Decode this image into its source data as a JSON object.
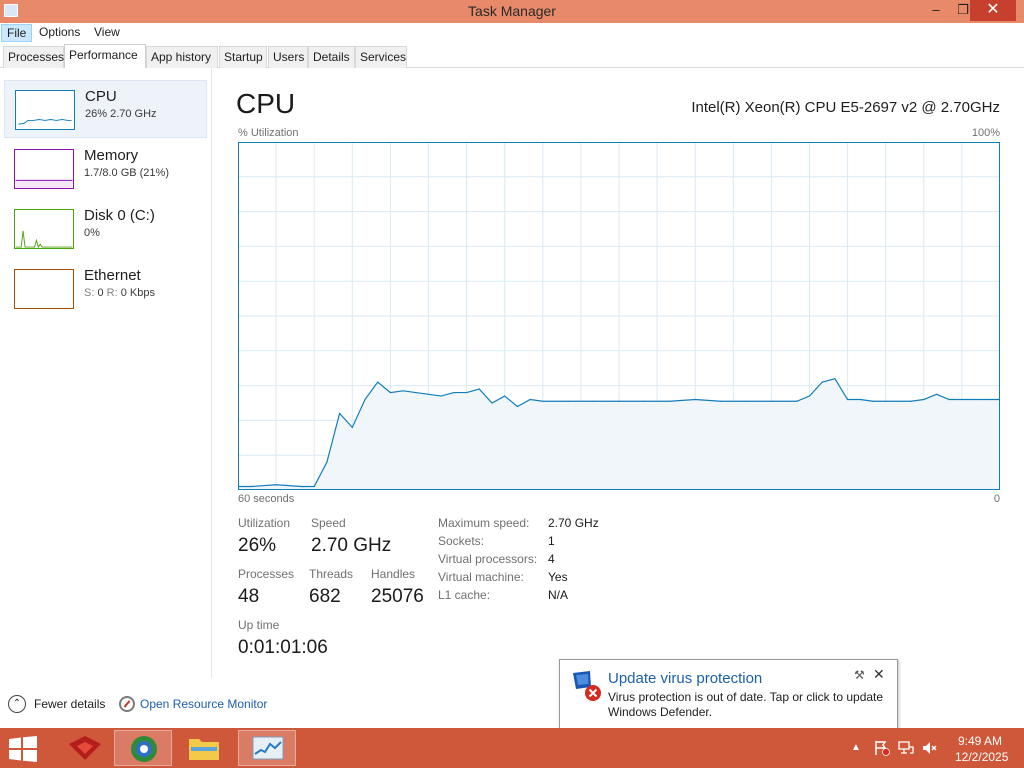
{
  "window": {
    "title": "Task Manager",
    "minimize": "–",
    "restore": "❐",
    "close": "✕"
  },
  "menu": [
    "File",
    "Options",
    "View"
  ],
  "tabs": [
    "Processes",
    "Performance",
    "App history",
    "Startup",
    "Users",
    "Details",
    "Services"
  ],
  "sidebar": {
    "cpu": {
      "title": "CPU",
      "sub": "26%  2.70 GHz"
    },
    "memory": {
      "title": "Memory",
      "sub": "1.7/8.0 GB (21%)"
    },
    "disk": {
      "title": "Disk 0 (C:)",
      "sub": "0%"
    },
    "ethernet": {
      "title": "Ethernet",
      "s_label": "S:",
      "s_value": "0",
      "r_label": "R:",
      "r_value": "0 Kbps"
    }
  },
  "main": {
    "title": "CPU",
    "cpu_model": "Intel(R) Xeon(R) CPU E5-2697 v2 @ 2.70GHz",
    "graph_label": "% Utilization",
    "graph_max": "100%",
    "graph_time": "60 seconds",
    "graph_min": "0"
  },
  "stats": {
    "utilization_label": "Utilization",
    "utilization": "26%",
    "speed_label": "Speed",
    "speed": "2.70 GHz",
    "processes_label": "Processes",
    "processes": "48",
    "threads_label": "Threads",
    "threads": "682",
    "handles_label": "Handles",
    "handles": "25076",
    "uptime_label": "Up time",
    "uptime": "0:01:01:06"
  },
  "details": [
    {
      "label": "Maximum speed:",
      "value": "2.70 GHz"
    },
    {
      "label": "Sockets:",
      "value": "1"
    },
    {
      "label": "Virtual processors:",
      "value": "4"
    },
    {
      "label": "Virtual machine:",
      "value": "Yes"
    },
    {
      "label": "L1 cache:",
      "value": "N/A"
    }
  ],
  "footer": {
    "fewer_details": "Fewer details",
    "open_resource_monitor": "Open Resource Monitor"
  },
  "toast": {
    "title": "Update virus protection",
    "body": "Virus protection is out of date. Tap or click to update Windows Defender."
  },
  "clock": {
    "time": "9:49 AM",
    "date": "12/2/2025"
  },
  "chart_data": {
    "type": "area",
    "xlabel": "60 seconds",
    "ylabel": "% Utilization",
    "ylim": [
      0,
      100
    ],
    "xlim": [
      60,
      0
    ],
    "x": [
      60,
      59,
      57,
      55,
      54,
      53,
      52,
      51,
      50,
      49,
      48,
      47,
      46,
      45,
      44,
      43,
      42,
      41,
      40,
      39,
      38,
      37,
      36,
      34,
      32,
      30,
      28,
      26,
      24,
      22,
      20,
      18,
      16,
      15,
      14,
      13,
      12,
      11,
      10,
      9,
      8,
      7,
      6,
      5,
      4,
      3,
      2,
      1,
      0
    ],
    "values": [
      1,
      1,
      1.5,
      1,
      1,
      8,
      22,
      18,
      26,
      31,
      28,
      28.5,
      28,
      27.5,
      27,
      28,
      28,
      29,
      25,
      27,
      24,
      26,
      25.5,
      25.5,
      25.5,
      25.5,
      25.5,
      25.5,
      26,
      25.5,
      25.5,
      25.5,
      25.5,
      27,
      31,
      32,
      26,
      26,
      25.5,
      25.5,
      25.5,
      25.5,
      26,
      27.5,
      26,
      26,
      26,
      26,
      26
    ],
    "grid": true,
    "color": "#117dbb",
    "fill": "#f1f6fa"
  },
  "colors": {
    "accent": "#117dbb",
    "titlebar": "#e8896a",
    "taskbar": "#d0583a",
    "memory": "#8b12ae",
    "disk": "#4da60c",
    "ethernet": "#a74f01",
    "link": "#1c5fae"
  }
}
